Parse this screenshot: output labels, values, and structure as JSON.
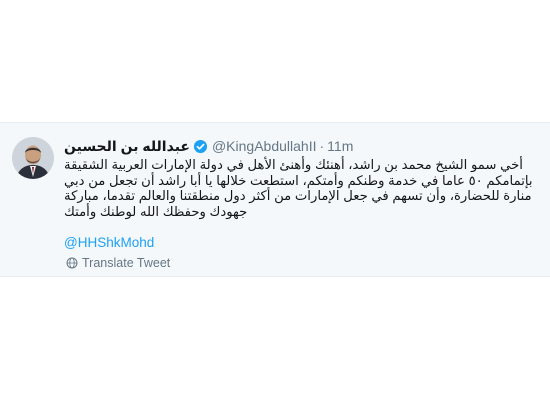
{
  "tweet": {
    "display_name": "عبدالله بن الحسين",
    "handle": "@KingAbdullahII",
    "separator": "·",
    "time": "11m",
    "body_lines": [
      "أخي سمو الشيخ محمد بن راشد، أهنئك وأهنئ الأهل في دولة الإمارات العربية الشقيقة",
      "بإتمامكم ٥٠ عاما في خدمة وطنكم وأمتكم، استطعت خلالها يا أبا راشد أن تجعل من دبي",
      "منارة للحضارة، وأن تسهم في جعل الإمارات من أكثر دول منطقتنا والعالم تقدما، مباركة",
      "جهودك وحفظك الله لوطنك وأمتك"
    ],
    "mention": "@HHShkMohd",
    "translate_label": "Translate Tweet",
    "verified_icon": "verified-badge-icon",
    "translate_icon": "globe-icon",
    "accent_color": "#1da1f2",
    "muted_color": "#657786"
  }
}
